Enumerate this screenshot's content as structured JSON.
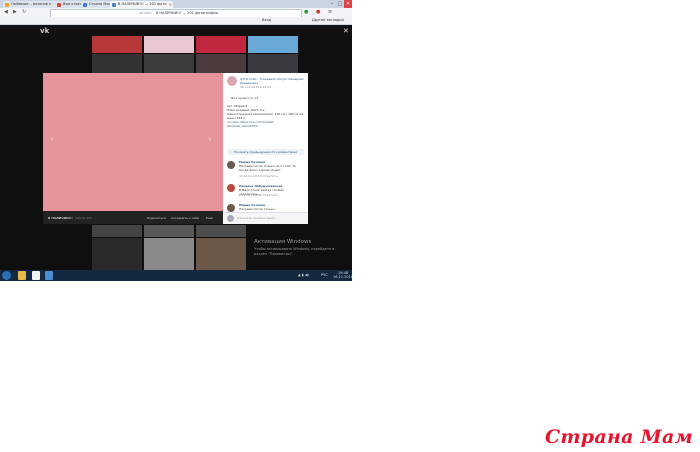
{
  "browser": {
    "tabs": [
      {
        "label": "Любимые... вязание к",
        "color": "#f2a22b"
      },
      {
        "label": "Вам ответ...",
        "color": "#e0453a"
      },
      {
        "label": "Страна Мам",
        "color": "#3b7ddd"
      },
      {
        "label": "В НАЛИЧИИ!!! — 201 фото",
        "color": "#5181b8"
      }
    ],
    "url": "В НАЛИЧИИ!!! — 201 фотография",
    "url_prefix": "vk.com",
    "bookmarks_right": "Другие закладки",
    "bookmark_item": "Вход",
    "window_controls": [
      "–",
      "□",
      "✕"
    ]
  },
  "photo_viewer": {
    "album_name": "В НАЛИЧИИ!!!",
    "photo_index": "134 из 201",
    "actions": [
      "Поделиться",
      "Сохранить к себе",
      "Ещё"
    ],
    "author": "ОЛ Уголёк - Тканевая/торгует Кемерово (Кемерово)",
    "date": "16 ноя 2018 в 19:01",
    "likes": "Мне нравится: 14",
    "description": [
      "арт. Мария 8",
      "Флис розовый 100% п.э.",
      "Односторонний антипиллинг 150 см / 180 гр м2",
      "цена: 185 р",
      "ссылка: https://vk.com/market-",
      "items/ab_Uwvdbit32"
    ],
    "show_prev": "Показать предыдущие 24 комментария",
    "comments": [
      {
        "name": "Мария Кулеша",
        "text": "Нагреем после только на 1 слой. То Когда флис хорошо будет",
        "meta": "15 ноя в 22:13 Ответить"
      },
      {
        "name": "Наталья Лабудымянская",
        "text": "В Двух слоях между слоями утеплитель...",
        "meta": "15 ноя в 20:08 Ответить"
      },
      {
        "name": "Мария Кулеша",
        "text": "Нагреем после только...",
        "meta": ""
      }
    ],
    "comment_placeholder": "Написать комментарий..."
  },
  "activation": {
    "title": "Активация Windows",
    "text": "Чтобы активировать Windows, перейдите в раздел \"Параметры\"."
  },
  "taskbar": {
    "clock_time": "19:48",
    "clock_date": "16.11.2018",
    "lang": "РУС"
  },
  "watermark": "Страна Мам"
}
